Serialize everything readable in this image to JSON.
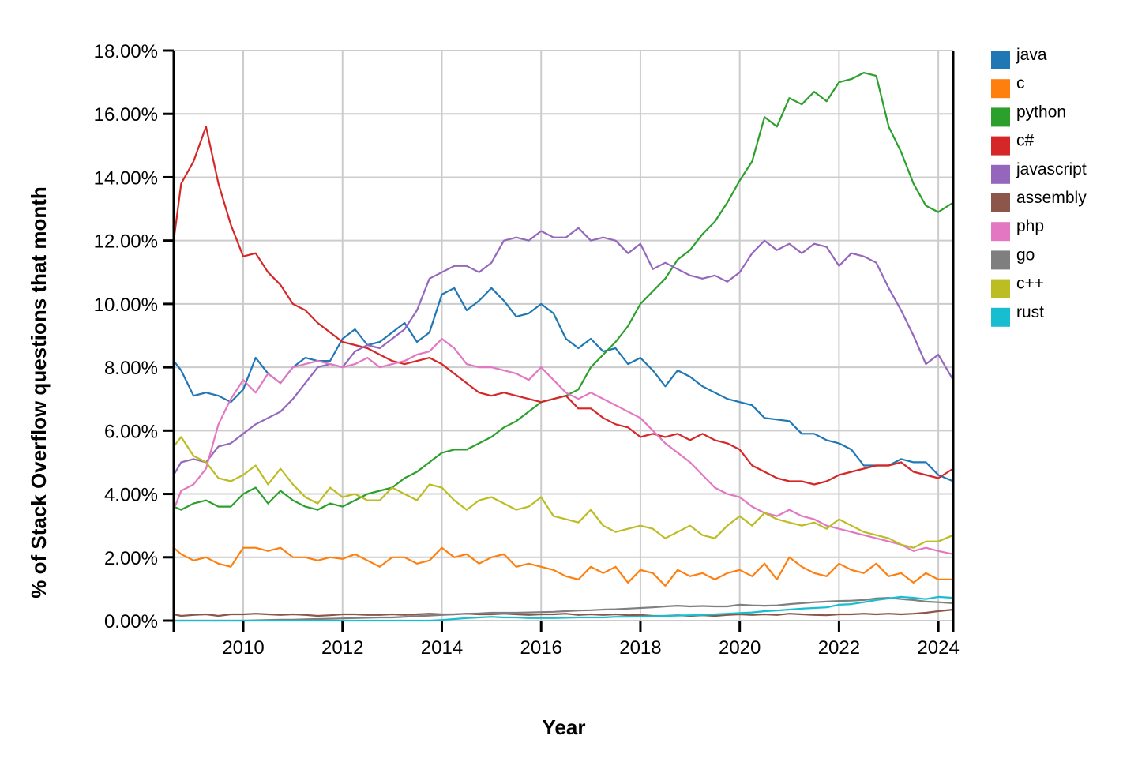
{
  "chart_data": {
    "type": "line",
    "title": "",
    "xlabel": "Year",
    "ylabel": "% of Stack Overflow questions that month",
    "xlim": [
      2008.6,
      2024.3
    ],
    "ylim": [
      0,
      18
    ],
    "grid": true,
    "legend_position": "right",
    "x_ticks": [
      2010,
      2012,
      2014,
      2016,
      2018,
      2020,
      2022,
      2024
    ],
    "x_tick_labels": [
      "2010",
      "2012",
      "2014",
      "2016",
      "2018",
      "2020",
      "2022",
      "2024"
    ],
    "y_ticks": [
      0,
      2,
      4,
      6,
      8,
      10,
      12,
      14,
      16,
      18
    ],
    "y_tick_labels": [
      "0.00%",
      "2.00%",
      "4.00%",
      "6.00%",
      "8.00%",
      "10.00%",
      "12.00%",
      "14.00%",
      "16.00%",
      "18.00%"
    ],
    "x": [
      2008.6,
      2008.75,
      2009.0,
      2009.25,
      2009.5,
      2009.75,
      2010.0,
      2010.25,
      2010.5,
      2010.75,
      2011.0,
      2011.25,
      2011.5,
      2011.75,
      2012.0,
      2012.25,
      2012.5,
      2012.75,
      2013.0,
      2013.25,
      2013.5,
      2013.75,
      2014.0,
      2014.25,
      2014.5,
      2014.75,
      2015.0,
      2015.25,
      2015.5,
      2015.75,
      2016.0,
      2016.25,
      2016.5,
      2016.75,
      2017.0,
      2017.25,
      2017.5,
      2017.75,
      2018.0,
      2018.25,
      2018.5,
      2018.75,
      2019.0,
      2019.25,
      2019.5,
      2019.75,
      2020.0,
      2020.25,
      2020.5,
      2020.75,
      2021.0,
      2021.25,
      2021.5,
      2021.75,
      2022.0,
      2022.25,
      2022.5,
      2022.75,
      2023.0,
      2023.25,
      2023.5,
      2023.75,
      2024.0,
      2024.3
    ],
    "series": [
      {
        "name": "java",
        "color": "#1f77b4",
        "values": [
          8.2,
          7.9,
          7.1,
          7.2,
          7.1,
          6.9,
          7.3,
          8.3,
          7.8,
          7.5,
          8.0,
          8.3,
          8.2,
          8.2,
          8.9,
          9.2,
          8.7,
          8.8,
          9.1,
          9.4,
          8.8,
          9.1,
          10.3,
          10.5,
          9.8,
          10.1,
          10.5,
          10.1,
          9.6,
          9.7,
          10.0,
          9.7,
          8.9,
          8.6,
          8.9,
          8.5,
          8.6,
          8.1,
          8.3,
          7.9,
          7.4,
          7.9,
          7.7,
          7.4,
          7.2,
          7.0,
          6.9,
          6.8,
          6.4,
          6.35,
          6.3,
          5.9,
          5.9,
          5.7,
          5.6,
          5.4,
          4.9,
          4.9,
          4.9,
          5.1,
          5.0,
          5.0,
          4.6,
          4.4
        ]
      },
      {
        "name": "c",
        "color": "#ff7f0e",
        "values": [
          2.3,
          2.1,
          1.9,
          2.0,
          1.8,
          1.7,
          2.3,
          2.3,
          2.2,
          2.3,
          2.0,
          2.0,
          1.9,
          2.0,
          1.95,
          2.1,
          1.9,
          1.7,
          2.0,
          2.0,
          1.8,
          1.9,
          2.3,
          2.0,
          2.1,
          1.8,
          2.0,
          2.1,
          1.7,
          1.8,
          1.7,
          1.6,
          1.4,
          1.3,
          1.7,
          1.5,
          1.7,
          1.2,
          1.6,
          1.5,
          1.1,
          1.6,
          1.4,
          1.5,
          1.3,
          1.5,
          1.6,
          1.4,
          1.8,
          1.3,
          2.0,
          1.7,
          1.5,
          1.4,
          1.8,
          1.6,
          1.5,
          1.8,
          1.4,
          1.5,
          1.2,
          1.5,
          1.3,
          1.3
        ]
      },
      {
        "name": "python",
        "color": "#2ca02c",
        "values": [
          3.6,
          3.5,
          3.7,
          3.8,
          3.6,
          3.6,
          4.0,
          4.2,
          3.7,
          4.1,
          3.8,
          3.6,
          3.5,
          3.7,
          3.6,
          3.8,
          4.0,
          4.1,
          4.2,
          4.5,
          4.7,
          5.0,
          5.3,
          5.4,
          5.4,
          5.6,
          5.8,
          6.1,
          6.3,
          6.6,
          6.9,
          7.0,
          7.1,
          7.3,
          8.0,
          8.4,
          8.8,
          9.3,
          10.0,
          10.4,
          10.8,
          11.4,
          11.7,
          12.2,
          12.6,
          13.2,
          13.9,
          14.5,
          15.9,
          15.6,
          16.5,
          16.3,
          16.7,
          16.4,
          17.0,
          17.1,
          17.3,
          17.2,
          15.6,
          14.8,
          13.8,
          13.1,
          12.9,
          13.2
        ]
      },
      {
        "name": "c#",
        "color": "#d62728",
        "values": [
          12.0,
          13.8,
          14.5,
          15.6,
          13.8,
          12.5,
          11.5,
          11.6,
          11.0,
          10.6,
          10.0,
          9.8,
          9.4,
          9.1,
          8.8,
          8.7,
          8.6,
          8.4,
          8.2,
          8.1,
          8.2,
          8.3,
          8.1,
          7.8,
          7.5,
          7.2,
          7.1,
          7.2,
          7.1,
          7.0,
          6.9,
          7.0,
          7.1,
          6.7,
          6.7,
          6.4,
          6.2,
          6.1,
          5.8,
          5.9,
          5.8,
          5.9,
          5.7,
          5.9,
          5.7,
          5.6,
          5.4,
          4.9,
          4.7,
          4.5,
          4.4,
          4.4,
          4.3,
          4.4,
          4.6,
          4.7,
          4.8,
          4.9,
          4.9,
          5.0,
          4.7,
          4.6,
          4.5,
          4.8
        ]
      },
      {
        "name": "javascript",
        "color": "#9467bd",
        "values": [
          4.6,
          5.0,
          5.1,
          5.0,
          5.5,
          5.6,
          5.9,
          6.2,
          6.4,
          6.6,
          7.0,
          7.5,
          8.0,
          8.1,
          8.0,
          8.5,
          8.7,
          8.6,
          8.9,
          9.2,
          9.8,
          10.8,
          11.0,
          11.2,
          11.2,
          11.0,
          11.3,
          12.0,
          12.1,
          12.0,
          12.3,
          12.1,
          12.1,
          12.4,
          12.0,
          12.1,
          12.0,
          11.6,
          11.9,
          11.1,
          11.3,
          11.1,
          10.9,
          10.8,
          10.9,
          10.7,
          11.0,
          11.6,
          12.0,
          11.7,
          11.9,
          11.6,
          11.9,
          11.8,
          11.2,
          11.6,
          11.5,
          11.3,
          10.5,
          9.8,
          9.0,
          8.1,
          8.4,
          7.6
        ]
      },
      {
        "name": "assembly",
        "color": "#8c564b",
        "values": [
          0.2,
          0.15,
          0.18,
          0.2,
          0.15,
          0.2,
          0.2,
          0.22,
          0.2,
          0.18,
          0.2,
          0.18,
          0.15,
          0.17,
          0.2,
          0.2,
          0.18,
          0.18,
          0.2,
          0.18,
          0.2,
          0.22,
          0.2,
          0.2,
          0.22,
          0.2,
          0.2,
          0.22,
          0.2,
          0.18,
          0.2,
          0.2,
          0.22,
          0.18,
          0.2,
          0.18,
          0.2,
          0.17,
          0.18,
          0.15,
          0.15,
          0.17,
          0.15,
          0.17,
          0.15,
          0.18,
          0.2,
          0.18,
          0.2,
          0.18,
          0.22,
          0.2,
          0.18,
          0.17,
          0.2,
          0.2,
          0.22,
          0.2,
          0.22,
          0.2,
          0.22,
          0.25,
          0.3,
          0.35
        ]
      },
      {
        "name": "php",
        "color": "#e377c2",
        "values": [
          3.5,
          4.1,
          4.3,
          4.8,
          6.2,
          7.0,
          7.6,
          7.2,
          7.8,
          7.5,
          8.0,
          8.1,
          8.2,
          8.1,
          8.0,
          8.1,
          8.3,
          8.0,
          8.1,
          8.2,
          8.4,
          8.5,
          8.9,
          8.6,
          8.1,
          8.0,
          8.0,
          7.9,
          7.8,
          7.6,
          8.0,
          7.6,
          7.2,
          7.0,
          7.2,
          7.0,
          6.8,
          6.6,
          6.4,
          6.0,
          5.6,
          5.3,
          5.0,
          4.6,
          4.2,
          4.0,
          3.9,
          3.6,
          3.4,
          3.3,
          3.5,
          3.3,
          3.2,
          3.0,
          2.9,
          2.8,
          2.7,
          2.6,
          2.5,
          2.4,
          2.2,
          2.3,
          2.2,
          2.1
        ]
      },
      {
        "name": "go",
        "color": "#7f7f7f",
        "values": [
          0.0,
          0.0,
          0.0,
          0.0,
          0.0,
          0.0,
          0.0,
          0.01,
          0.02,
          0.03,
          0.03,
          0.04,
          0.05,
          0.06,
          0.07,
          0.08,
          0.09,
          0.1,
          0.1,
          0.12,
          0.14,
          0.16,
          0.18,
          0.2,
          0.22,
          0.23,
          0.25,
          0.25,
          0.25,
          0.26,
          0.27,
          0.28,
          0.3,
          0.32,
          0.33,
          0.35,
          0.36,
          0.38,
          0.4,
          0.42,
          0.45,
          0.47,
          0.45,
          0.46,
          0.45,
          0.45,
          0.5,
          0.48,
          0.47,
          0.48,
          0.52,
          0.55,
          0.58,
          0.6,
          0.62,
          0.63,
          0.65,
          0.7,
          0.72,
          0.68,
          0.65,
          0.6,
          0.58,
          0.55
        ]
      },
      {
        "name": "c++",
        "color": "#bcbd22",
        "values": [
          5.5,
          5.8,
          5.2,
          5.0,
          4.5,
          4.4,
          4.6,
          4.9,
          4.3,
          4.8,
          4.3,
          3.9,
          3.7,
          4.2,
          3.9,
          4.0,
          3.8,
          3.8,
          4.2,
          4.0,
          3.8,
          4.3,
          4.2,
          3.8,
          3.5,
          3.8,
          3.9,
          3.7,
          3.5,
          3.6,
          3.9,
          3.3,
          3.2,
          3.1,
          3.5,
          3.0,
          2.8,
          2.9,
          3.0,
          2.9,
          2.6,
          2.8,
          3.0,
          2.7,
          2.6,
          3.0,
          3.3,
          3.0,
          3.4,
          3.2,
          3.1,
          3.0,
          3.1,
          2.9,
          3.2,
          3.0,
          2.8,
          2.7,
          2.6,
          2.4,
          2.3,
          2.5,
          2.5,
          2.7
        ]
      },
      {
        "name": "rust",
        "color": "#17becf",
        "values": [
          0.0,
          0.0,
          0.0,
          0.0,
          0.0,
          0.0,
          0.0,
          0.0,
          0.0,
          0.0,
          0.0,
          0.0,
          0.0,
          0.0,
          0.0,
          0.0,
          0.0,
          0.0,
          0.0,
          0.0,
          0.0,
          0.0,
          0.02,
          0.05,
          0.08,
          0.1,
          0.12,
          0.1,
          0.1,
          0.08,
          0.08,
          0.08,
          0.09,
          0.1,
          0.1,
          0.1,
          0.12,
          0.12,
          0.13,
          0.14,
          0.15,
          0.16,
          0.17,
          0.18,
          0.2,
          0.22,
          0.24,
          0.26,
          0.3,
          0.32,
          0.35,
          0.38,
          0.4,
          0.42,
          0.5,
          0.52,
          0.58,
          0.65,
          0.7,
          0.75,
          0.72,
          0.68,
          0.75,
          0.72
        ]
      }
    ]
  }
}
